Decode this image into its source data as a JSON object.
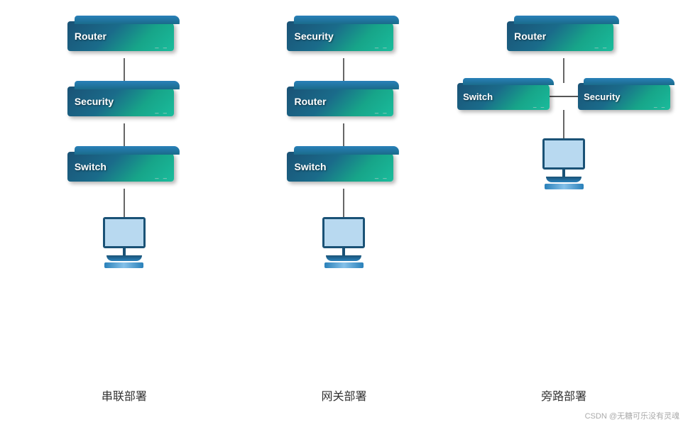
{
  "diagrams": [
    {
      "id": "serial",
      "caption": "串联部署",
      "devices": [
        "Router",
        "Security",
        "Switch"
      ]
    },
    {
      "id": "gateway",
      "caption": "网关部署",
      "devices": [
        "Security",
        "Router",
        "Switch"
      ]
    },
    {
      "id": "bypass",
      "caption": "旁路部署",
      "mainDevice": "Router",
      "branchLeft": "Switch",
      "branchRight": "Security"
    }
  ],
  "watermark": "CSDN @无糖可乐没有灵魂"
}
